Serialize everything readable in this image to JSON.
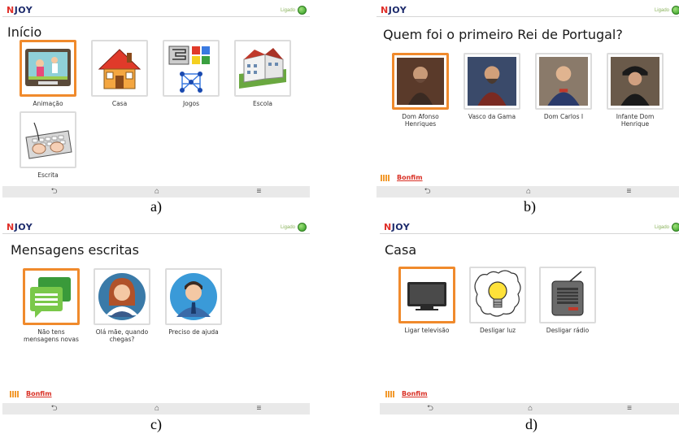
{
  "app": {
    "logo_n": "N",
    "logo_rest": "JOY",
    "status_label": "Ligado"
  },
  "panel_a": {
    "title": "Início",
    "tiles": [
      {
        "label": "Animação"
      },
      {
        "label": "Casa"
      },
      {
        "label": "Jogos"
      },
      {
        "label": "Escola"
      },
      {
        "label": "Escrita"
      }
    ],
    "caption": "a)"
  },
  "panel_b": {
    "title": "Quem foi o primeiro Rei de Portugal?",
    "tiles": [
      {
        "label": "Dom Afonso Henriques"
      },
      {
        "label": "Vasco da Gama"
      },
      {
        "label": "Dom Carlos I"
      },
      {
        "label": "Infante Dom Henrique"
      }
    ],
    "caption": "b)"
  },
  "panel_c": {
    "title": "Mensagens escritas",
    "tiles": [
      {
        "label": "Não tens mensagens novas"
      },
      {
        "label": "Olá mãe, quando chegas?"
      },
      {
        "label": "Preciso de ajuda"
      }
    ],
    "caption": "c)"
  },
  "panel_d": {
    "title": "Casa",
    "tiles": [
      {
        "label": "Ligar televisão"
      },
      {
        "label": "Desligar luz"
      },
      {
        "label": "Desligar rádio"
      }
    ],
    "caption": "d)"
  },
  "footer": {
    "brand": "Bonfim"
  },
  "navbar": {
    "back": "⮌",
    "home": "⌂",
    "menu": "≡"
  },
  "colors": {
    "selected_border": "#f08a2c",
    "logo_n": "#e0302a",
    "logo_rest": "#1c2a6b",
    "status": "#8ab35c"
  }
}
